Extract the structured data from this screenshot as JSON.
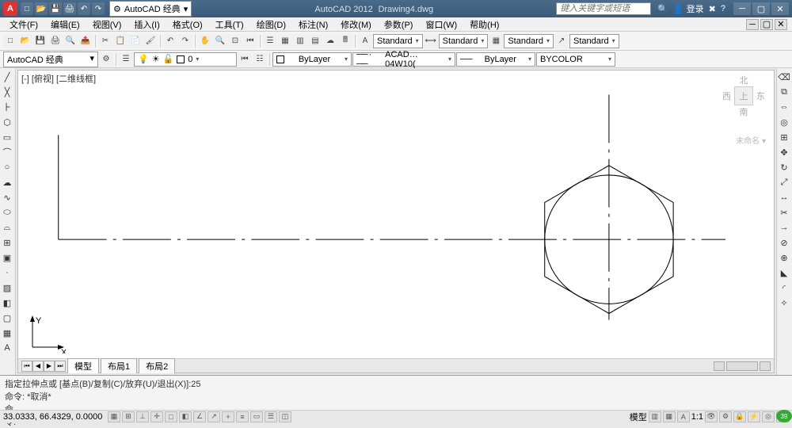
{
  "app": {
    "name": "AutoCAD 2012",
    "document": "Drawing4.dwg",
    "logo_letter": "A"
  },
  "titlebar": {
    "workspace_label": "AutoCAD 经典",
    "search_placeholder": "键入关键字或短语",
    "login_label": "登录",
    "qat_icons": [
      "new",
      "open",
      "save",
      "print",
      "undo",
      "redo"
    ]
  },
  "menu": {
    "items": [
      "文件(F)",
      "编辑(E)",
      "视图(V)",
      "插入(I)",
      "格式(O)",
      "工具(T)",
      "绘图(D)",
      "标注(N)",
      "修改(M)",
      "参数(P)",
      "窗口(W)",
      "帮助(H)"
    ]
  },
  "toolbars": {
    "annotation_styles": {
      "text_style": "Standard",
      "dim_style": "Standard",
      "table_style": "Standard",
      "mleader_style": "Standard"
    },
    "layer_props": {
      "color": "ByLayer",
      "linetype": "ACAD…04W10(",
      "lineweight": "ByLayer",
      "plot_style": "BYCOLOR"
    },
    "workspace": "AutoCAD 经典",
    "current_layer": "0"
  },
  "viewport": {
    "label": "[-] [俯视] [二维线框]",
    "viewcube": {
      "n": "北",
      "s": "南",
      "e": "东",
      "w": "西",
      "top": "上"
    },
    "nav_label": "未命名 ▾"
  },
  "tabs": {
    "items": [
      "模型",
      "布局1",
      "布局2"
    ],
    "active": 0
  },
  "command": {
    "history1": "指定拉伸点或 [基点(B)/复制(C)/放弃(U)/退出(X)]:25",
    "history2": "命令: *取消*",
    "prompt": "命令:"
  },
  "status": {
    "coords": "33.0333, 66.4329, 0.0000",
    "model_label": "模型",
    "scale": "1:1",
    "badge": "39"
  }
}
